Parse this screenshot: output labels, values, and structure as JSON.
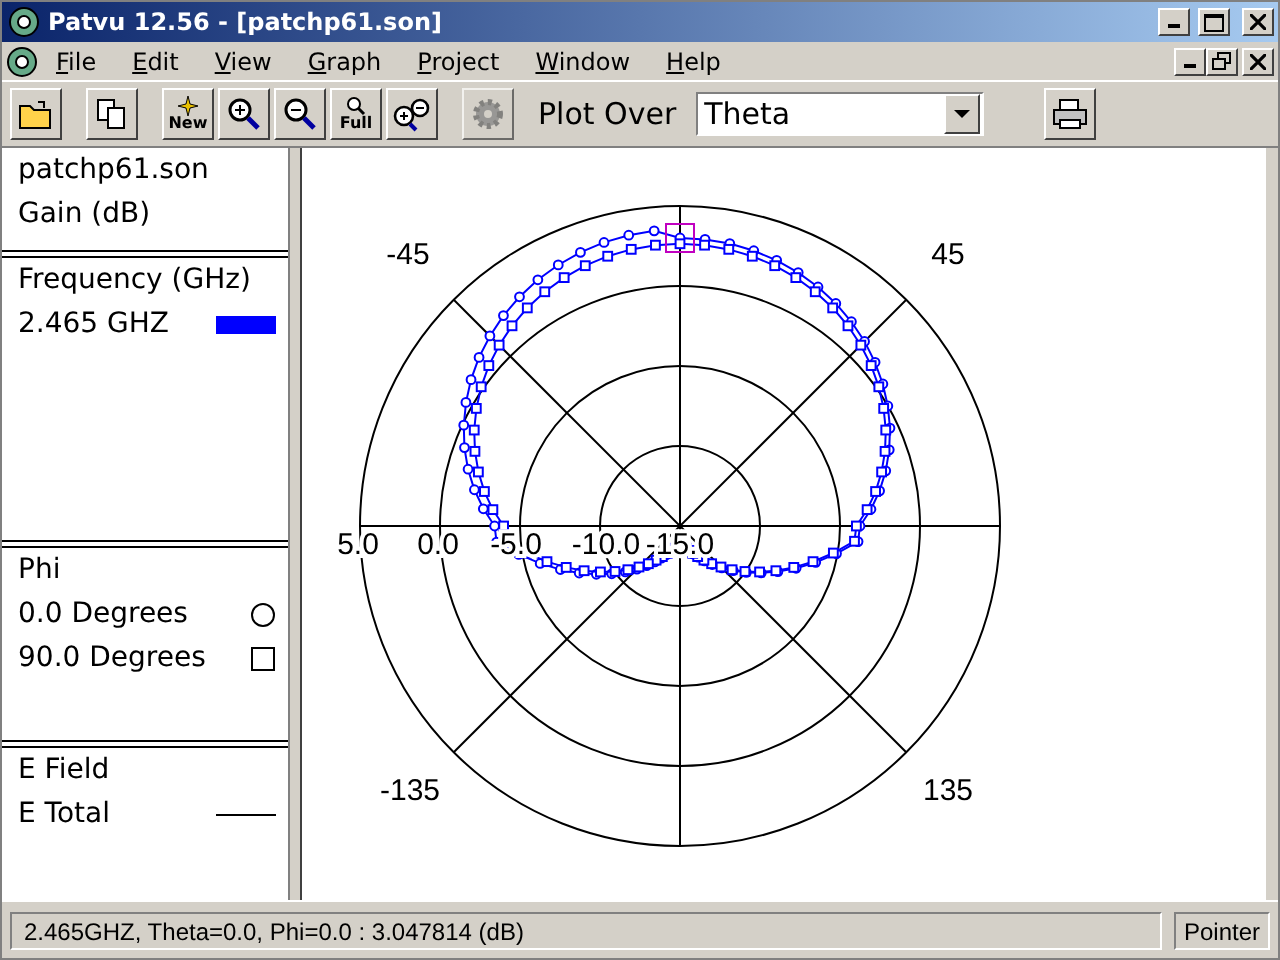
{
  "window": {
    "title": "Patvu 12.56 - [patchp61.son]"
  },
  "menu": [
    "File",
    "Edit",
    "View",
    "Graph",
    "Project",
    "Window",
    "Help"
  ],
  "toolbar": {
    "buttons": [
      {
        "kind": "open",
        "disabled": false
      },
      {
        "kind": "copy",
        "disabled": false
      },
      {
        "kind": "new",
        "label": "New",
        "disabled": false
      },
      {
        "kind": "zoom-in",
        "disabled": false
      },
      {
        "kind": "zoom-out",
        "disabled": false
      },
      {
        "kind": "full",
        "label": "Full",
        "disabled": false
      },
      {
        "kind": "zoom-both",
        "disabled": false
      },
      {
        "kind": "gear",
        "disabled": true
      }
    ],
    "plot_over": {
      "label": "Plot Over",
      "value": "Theta"
    }
  },
  "sidebar": {
    "file": "patchp61.son",
    "quantity": "Gain (dB)",
    "frequency": {
      "heading": "Frequency (GHz)",
      "items": [
        {
          "label": "2.465 GHZ",
          "color": "#0000ff"
        }
      ]
    },
    "phi": {
      "heading": "Phi",
      "items": [
        {
          "label": "0.0 Degrees",
          "kind": "circle"
        },
        {
          "label": "90.0 Degrees",
          "kind": "square"
        }
      ]
    },
    "field": {
      "heading": "E Field",
      "items": [
        {
          "label": "E Total",
          "kind": "solid"
        }
      ]
    }
  },
  "plot": {
    "angle_labels": [
      "-45",
      "45",
      "-135",
      "135"
    ],
    "radial_labels": [
      "5.0",
      "0.0",
      "-5.0",
      "-10.0",
      "-15.0"
    ]
  },
  "status_bar": {
    "message": "2.465GHZ, Theta=0.0, Phi=0.0 :  3.047814 (dB)",
    "mode": "Pointer"
  }
}
